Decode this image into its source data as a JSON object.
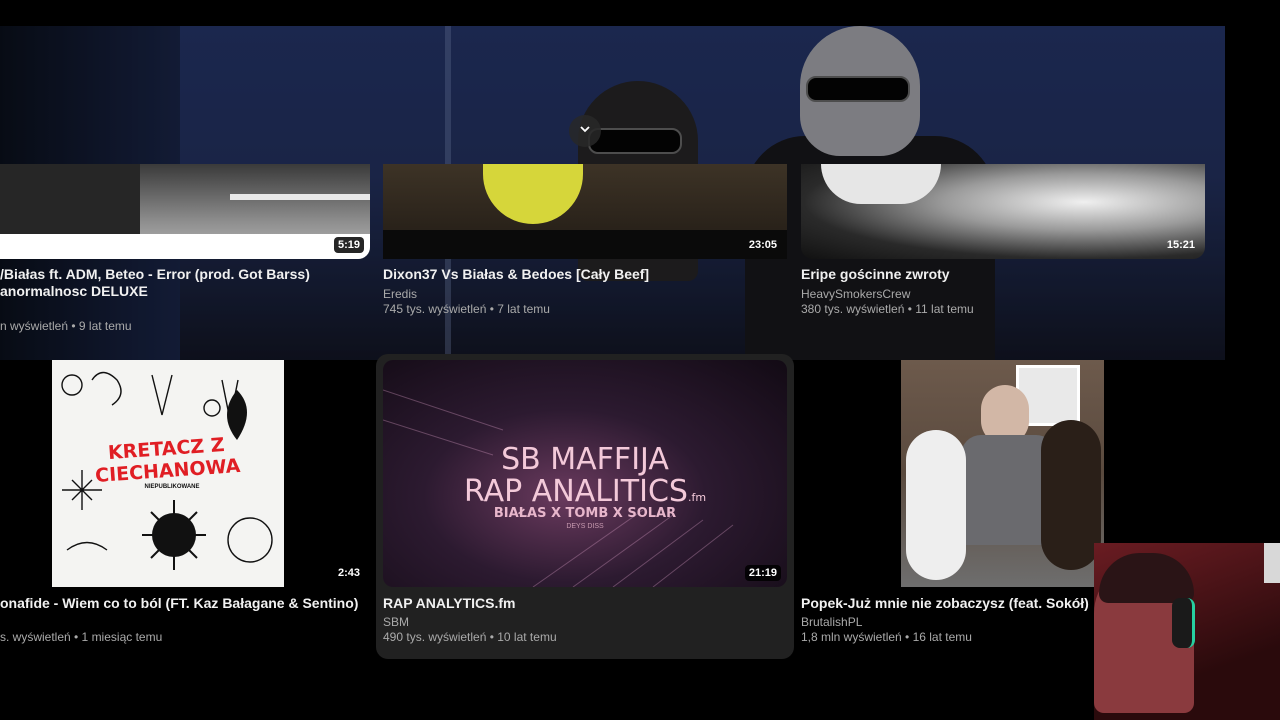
{
  "colors": {
    "accent": "#f1f1f1",
    "secondary_text": "#aaaaaa",
    "background": "#000000"
  },
  "icons": {
    "expand": "chevron-down-icon"
  },
  "videos": [
    {
      "title_line1": "/Białas ft. ADM, Beteo - Error (prod. Got Barss)",
      "title_line2": "anormalnosc DELUXE",
      "channel": "",
      "meta": "n wyświetleń • 9 lat temu",
      "duration": "5:19"
    },
    {
      "title_line1": "Dixon37 Vs Białas & Bedoes [Cały Beef]",
      "channel": "Eredis",
      "meta": "745 tys. wyświetleń • 7 lat temu",
      "duration": "23:05"
    },
    {
      "title_line1": "Eripe gościnne zwroty",
      "channel": "HeavySmokersCrew",
      "meta": "380 tys. wyświetleń • 11 lat temu",
      "duration": "15:21"
    },
    {
      "title_line1": "onafide - Wiem co to ból (FT. Kaz Bałagane & Sentino)",
      "channel": "",
      "meta": "s. wyświetleń • 1 miesiąc temu",
      "duration": "2:43",
      "thumb_text": "KRETACZ Z CIECHANOWA",
      "thumb_sub": "NIEPUBLIKOWANE"
    },
    {
      "title_line1": "RAP ANALYTICS.fm",
      "channel": "SBM",
      "meta": "490 tys. wyświetleń • 10 lat temu",
      "duration": "21:19",
      "thumb_line1": "SB MAFFIJA",
      "thumb_line2": "RAP ANALITICS",
      "thumb_fm": ".fm",
      "thumb_line3": "BIAŁAS X TOMB X SOLAR",
      "thumb_line4": "DEYS DISS"
    },
    {
      "title_line1": "Popek-Już mnie nie zobaczysz (feat. Sokół)",
      "channel": "BrutalishPL",
      "meta": "1,8 mln wyświetleń • 16 lat temu",
      "duration": ""
    }
  ]
}
